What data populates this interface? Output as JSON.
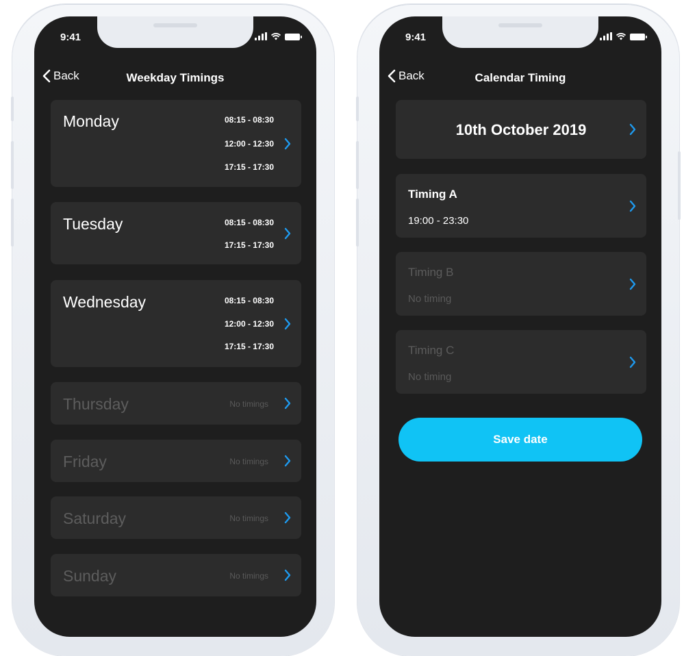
{
  "colors": {
    "accent": "#1e9bf0",
    "screen_bg": "#1e1e1e",
    "card_bg": "#2c2c2c",
    "save_button": "#10c3f5"
  },
  "left_phone": {
    "status_time": "9:41",
    "nav": {
      "back_label": "Back",
      "title": "Weekday Timings"
    },
    "days": [
      {
        "name": "Monday",
        "slots": [
          "08:15 - 08:30",
          "12:00 - 12:30",
          "17:15 - 17:30"
        ]
      },
      {
        "name": "Tuesday",
        "slots": [
          "08:15 - 08:30",
          "17:15 - 17:30"
        ]
      },
      {
        "name": "Wednesday",
        "slots": [
          "08:15 - 08:30",
          "12:00 - 12:30",
          "17:15 - 17:30"
        ]
      },
      {
        "name": "Thursday",
        "empty_label": "No timings"
      },
      {
        "name": "Friday",
        "empty_label": "No timings"
      },
      {
        "name": "Saturday",
        "empty_label": "No timings"
      },
      {
        "name": "Sunday",
        "empty_label": "No timings"
      }
    ]
  },
  "right_phone": {
    "status_time": "9:41",
    "nav": {
      "back_label": "Back",
      "title": "Calendar Timing"
    },
    "date": "10th October 2019",
    "timings": [
      {
        "title": "Timing A",
        "value": "19:00 - 23:30"
      },
      {
        "title": "Timing B",
        "value": "No timing"
      },
      {
        "title": "Timing C",
        "value": "No timing"
      }
    ],
    "save_label": "Save date"
  }
}
